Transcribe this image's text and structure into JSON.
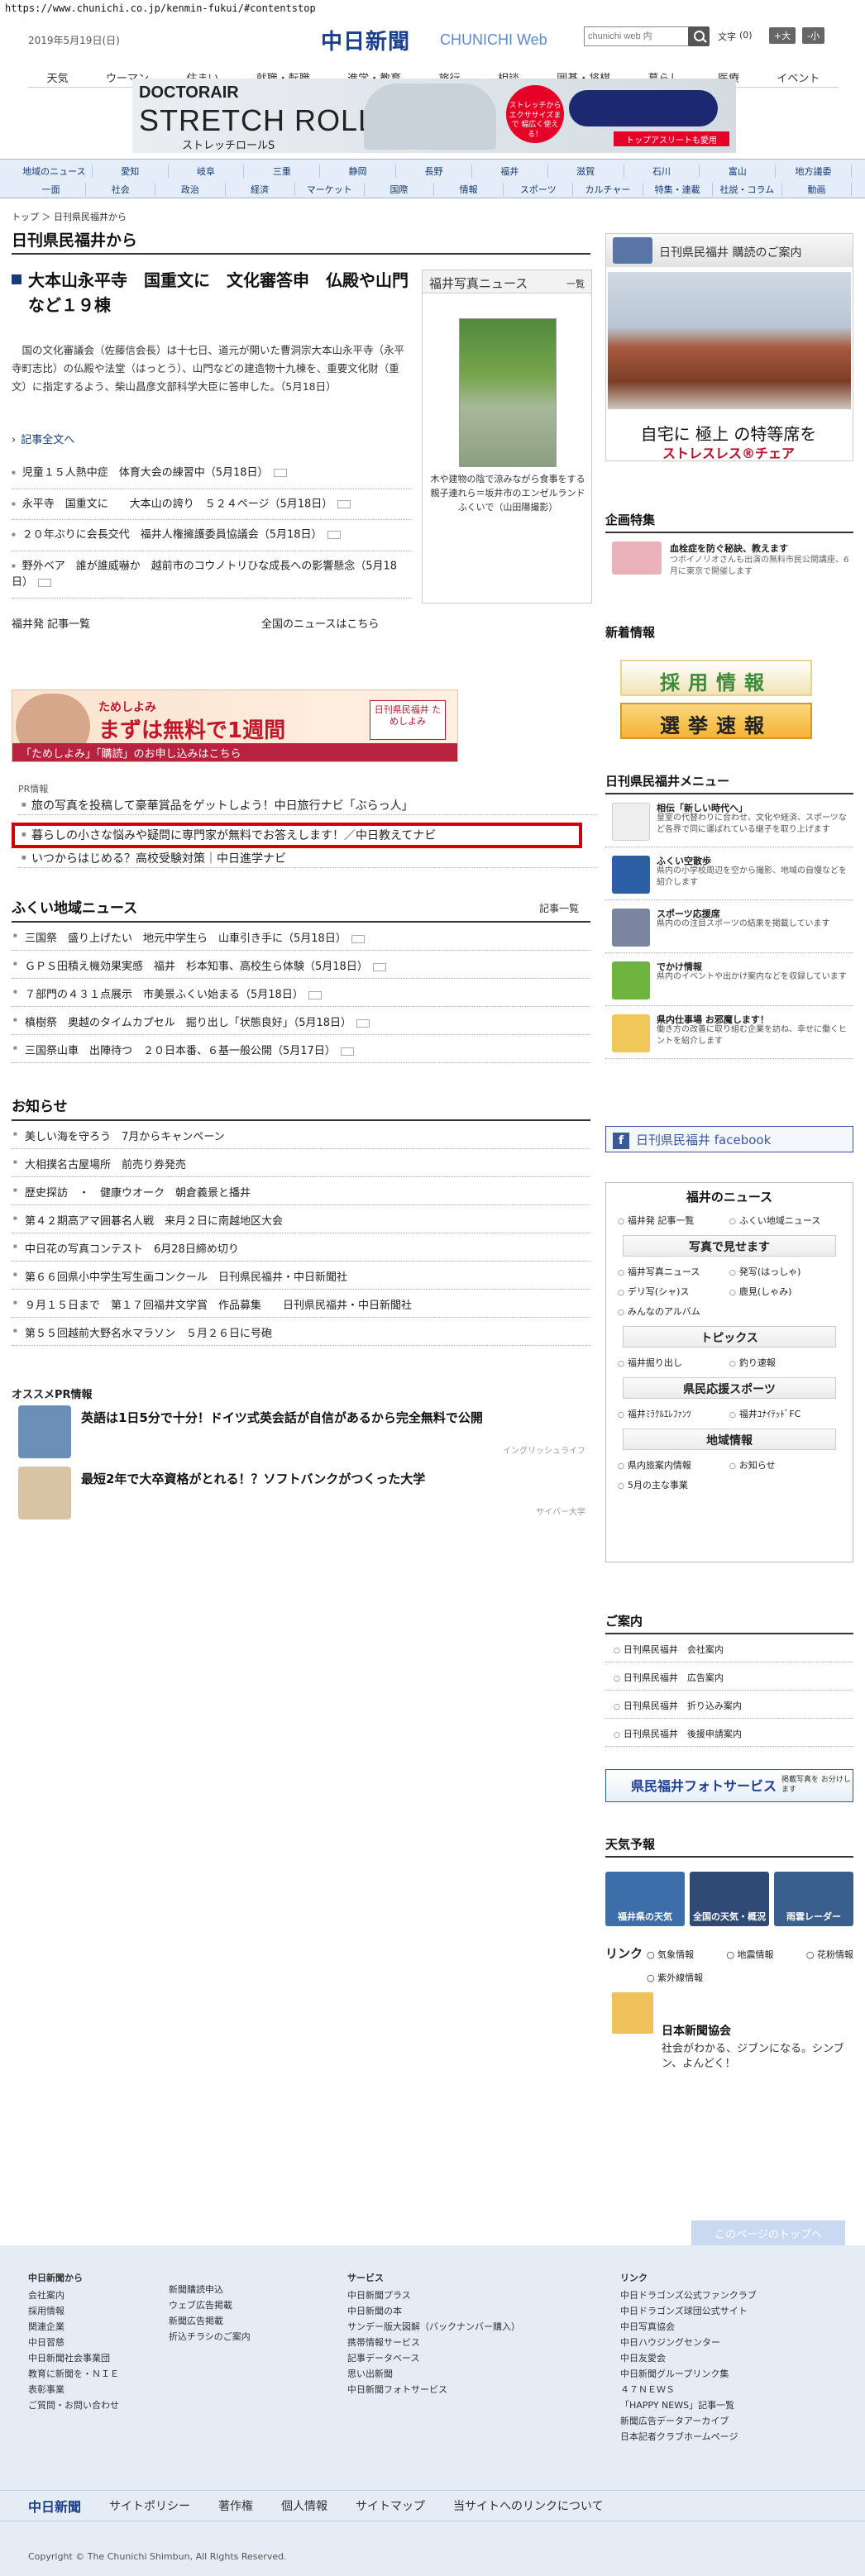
{
  "url": "https://www.chunichi.co.jp/kenmin-fukui/#contentstop",
  "header": {
    "date": "2019年5月19日(日)",
    "logo": "中日新聞",
    "logo_sub": "CHUNICHI Web",
    "search_placeholder": "chunichi web 内",
    "font_label": "文字",
    "font_reset": "(0)",
    "font_large": "+大",
    "font_small": "-小",
    "nav": [
      "天気",
      "ウーマン",
      "住まい",
      "就職・転職",
      "進学・教育",
      "旅行",
      "相談",
      "囲碁・将棋",
      "暮らし",
      "医療",
      "イベント"
    ]
  },
  "ad1": {
    "brand": "DOCTORAIR",
    "title": "STRETCH ROLL |S|",
    "sub": "ストレッチロールS",
    "circle": "ストレッチから エクササイズまで 幅広く使える！",
    "button": "トップアスリートも愛用"
  },
  "catnav": {
    "row1": [
      "地域のニュース",
      "愛知",
      "岐阜",
      "三重",
      "静岡",
      "長野",
      "福井",
      "滋賀",
      "石川",
      "富山",
      "地方議委"
    ],
    "row2": [
      "一面",
      "社会",
      "政治",
      "経済",
      "マーケット",
      "国際",
      "情報",
      "スポーツ",
      "カルチャー",
      "特集・連載",
      "社説・コラム",
      "動画"
    ]
  },
  "breadcrumb": "トップ ＞ 日刊県民福井から",
  "page_title": "日刊県民福井から",
  "lead": {
    "title": "大本山永平寺　国重文に　文化審答申　仏殿や山門など１９棟",
    "body": "国の文化審議会（佐藤信会長）は十七日、道元が開いた曹洞宗大本山永平寺（永平寺町志比）の仏殿や法堂（はっとう）、山門などの建造物十九棟を、重要文化財（重文）に指定するよう、柴山昌彦文部科学大臣に答申した。（5月18日）",
    "more": "記事全文へ"
  },
  "articles": [
    "児童１５人熱中症　体育大会の練習中（5月18日）",
    "永平寺　国重文に　　大本山の誇り　５２４ページ（5月18日）",
    "２０年ぶりに会長交代　福井人権擁護委員協議会（5月18日）",
    "野外ベア　誰が誰威嚇か　越前市のコウノトリひな成長への影響懸念（5月18日）"
  ],
  "links": {
    "left": "福井発 記事一覧",
    "right": "全国のニュースはこちら"
  },
  "photo_news": {
    "title": "福井写真ニュース",
    "more": "一覧",
    "caption": "木や建物の陰で涼みながら食事をする親子連れら＝坂井市のエンゼルランドふくいで（山田陽撮影）"
  },
  "ad2": {
    "t1": "ためしよみ",
    "t2": "まずは無料で1週間",
    "logo": "日刊県民福井 ためしよみ",
    "bar": "「ためしよみ」「購読」のお申し込みはこちら"
  },
  "pr": {
    "label": "PR情報",
    "items": [
      "旅の写真を投稿して豪華賞品をゲットしよう！中日旅行ナビ「ぶらっ人」",
      "暮らしの小さな悩みや疑問に専門家が無料でお答えします！／中日教えてナビ",
      "いつからはじめる？高校受験対策｜中日進学ナビ"
    ]
  },
  "region_news": {
    "title": "ふくい地域ニュース",
    "more": "記事一覧",
    "items": [
      "三国祭　盛り上げたい　地元中学生ら　山車引き手に（5月18日）",
      "ＧＰＳ田積え機効果実感　福井　杉本知事、高校生ら体験（5月18日）",
      "７部門の４３１点展示　市美景ふくい始まる（5月18日）",
      "槙樹祭　奥越のタイムカプセル　掘り出し「状態良好」（5月18日）",
      "三国祭山車　出陣待つ　２０日本番、６基一般公開（5月17日）"
    ]
  },
  "notices": {
    "title": "お知らせ",
    "items": [
      "美しい海を守ろう　7月からキャンペーン",
      "大相撲名古屋場所　前売り券発売",
      "歴史探訪　・　健康ウオーク　朝倉義景と播井",
      "第４２期高アマ囲碁名人戦　来月２日に南越地区大会",
      "中日花の写真コンテスト　6月28日締め切り",
      "第６６回県小中学生写生画コンクール　日刊県民福井・中日新聞社",
      "９月１５日まで　第１７回福井文学賞　作品募集　　日刊県民福井・中日新聞社",
      "第５５回越前大野名水マラソン　５月２６日に号砲"
    ]
  },
  "osusume": {
    "title": "オススメPR情報",
    "items": [
      {
        "title": "英語は1日5分で十分！ドイツ式英会話が自信があるから完全無料で公開",
        "sponsor": "イングリッシュライフ"
      },
      {
        "title": "最短2年で大卒資格がとれる！？ソフトバンクがつくった大学",
        "sponsor": "サイバー大学"
      }
    ]
  },
  "right": {
    "kodoku": {
      "title": "日刊県民福井 購読のご案内",
      "c1": "自宅に 極上 の特等席を",
      "c2": "ストレスレス®チェア"
    },
    "tokushu": {
      "title": "企画特集",
      "item_title": "血栓症を防ぐ秘訣、教えます",
      "item_desc": "つボイノリオさんも出演の無料市民公開講座、6月に東京で開催します"
    },
    "shinchaku": {
      "title": "新着情報",
      "b1": "採用情報",
      "b2": "選挙速報"
    },
    "menu": {
      "title": "日刊県民福井メニュー",
      "items": [
        {
          "t": "相伝「新しい時代へ」",
          "d": "皇室の代替わりに合わせ、文化や経済、スポーツなど各界で同に運ばれている継子を取り上げます"
        },
        {
          "t": "ふくい空散歩",
          "d": "県内の小学校周辺を空から撮影、地域の自慢などを紹介します"
        },
        {
          "t": "スポーツ応援席",
          "d": "県内のの注目スポーツの結果を掲載しています"
        },
        {
          "t": "でかけ情報",
          "d": "県内のイベントや出かけ案内などを収録しています"
        },
        {
          "t": "県内仕事場 お邪魔します！",
          "d": "働き方の改善に取り組む企業を訪ね、幸せに働くヒントを紹介します"
        }
      ]
    },
    "facebook": "日刊県民福井 facebook",
    "fukui_news": {
      "title": "福井のニュース",
      "g1": [
        "福井発 記事一覧",
        "ふくい地域ニュース"
      ],
      "s2": "写真で見せます",
      "g2": [
        "福井写真ニュース",
        "発写(はっしゃ)",
        "デリ写(シャ)ス",
        "鹿見(しゃみ)",
        "みんなのアルバム"
      ],
      "s3": "トピックス",
      "g3": [
        "福井掘り出し",
        "釣り速報"
      ],
      "s4": "県民応援スポーツ",
      "g4": [
        "福井ﾐﾗｸﾙｴﾚﾌｧﾝﾂ",
        "福井ﾕﾅｲﾃｯﾄﾞFC"
      ],
      "s5": "地域情報",
      "g5": [
        "県内旅案内情報",
        "お知らせ",
        "5月の主な事業"
      ]
    },
    "guide": {
      "title": "ご案内",
      "items": [
        "日刊県民福井　会社案内",
        "日刊県民福井　広告案内",
        "日刊県民福井　折り込み案内",
        "日刊県民福井　後援申請案内"
      ]
    },
    "photo_service": {
      "title": "県民福井フォトサービス",
      "desc": "掲載写真を お分けします"
    },
    "weather": {
      "title": "天気予報",
      "items": [
        "福井県の天気",
        "全国の天気・概況",
        "雨雲レーダー"
      ]
    },
    "link": {
      "title": "リンク",
      "items": [
        "気象情報",
        "地震情報",
        "花粉情報"
      ],
      "extra": "紫外線情報"
    },
    "nihonshinbun": {
      "title": "日本新聞協会",
      "desc": "社会がわかる、ジブンになる。シンブン、よんどく！"
    }
  },
  "pagetop": "このページのトップへ",
  "footer": {
    "c1h": "中日新聞から",
    "c1": [
      "会社案内",
      "採用情報",
      "関連企業",
      "中日習慈",
      "中日新聞社会事業団",
      "教育に新聞を・ＮＩＥ",
      "表彰事業",
      "ご質問・お問い合わせ"
    ],
    "c2": [
      "新聞購読申込",
      "ウェブ広告掲載",
      "新聞広告掲載",
      "折込チラシのご案内"
    ],
    "c3h": "サービス",
    "c3": [
      "中日新聞プラス",
      "中日新聞の本",
      "サンデー版大図解（バックナンバー購入）",
      "携帯情報サービス",
      "記事データベース",
      "思い出新聞",
      "中日新聞フォトサービス"
    ],
    "c4h": "リンク",
    "c4": [
      "中日ドラゴンズ公式ファンクラブ",
      "中日ドラゴンズ球団公式サイト",
      "中日写真協会",
      "中日ハウジングセンター",
      "中日友愛会",
      "中日新聞グループリンク集",
      "４７ＮＥＷＳ",
      "「HAPPY NEWS」記事一覧",
      "新聞広告データアーカイブ",
      "日本記者クラブホームページ"
    ],
    "bar": [
      "中日新聞",
      "サイトポリシー",
      "著作権",
      "個人情報",
      "サイトマップ",
      "当サイトへのリンクについて"
    ],
    "copyright": "Copyright © The Chunichi Shimbun, All Rights Reserved."
  }
}
